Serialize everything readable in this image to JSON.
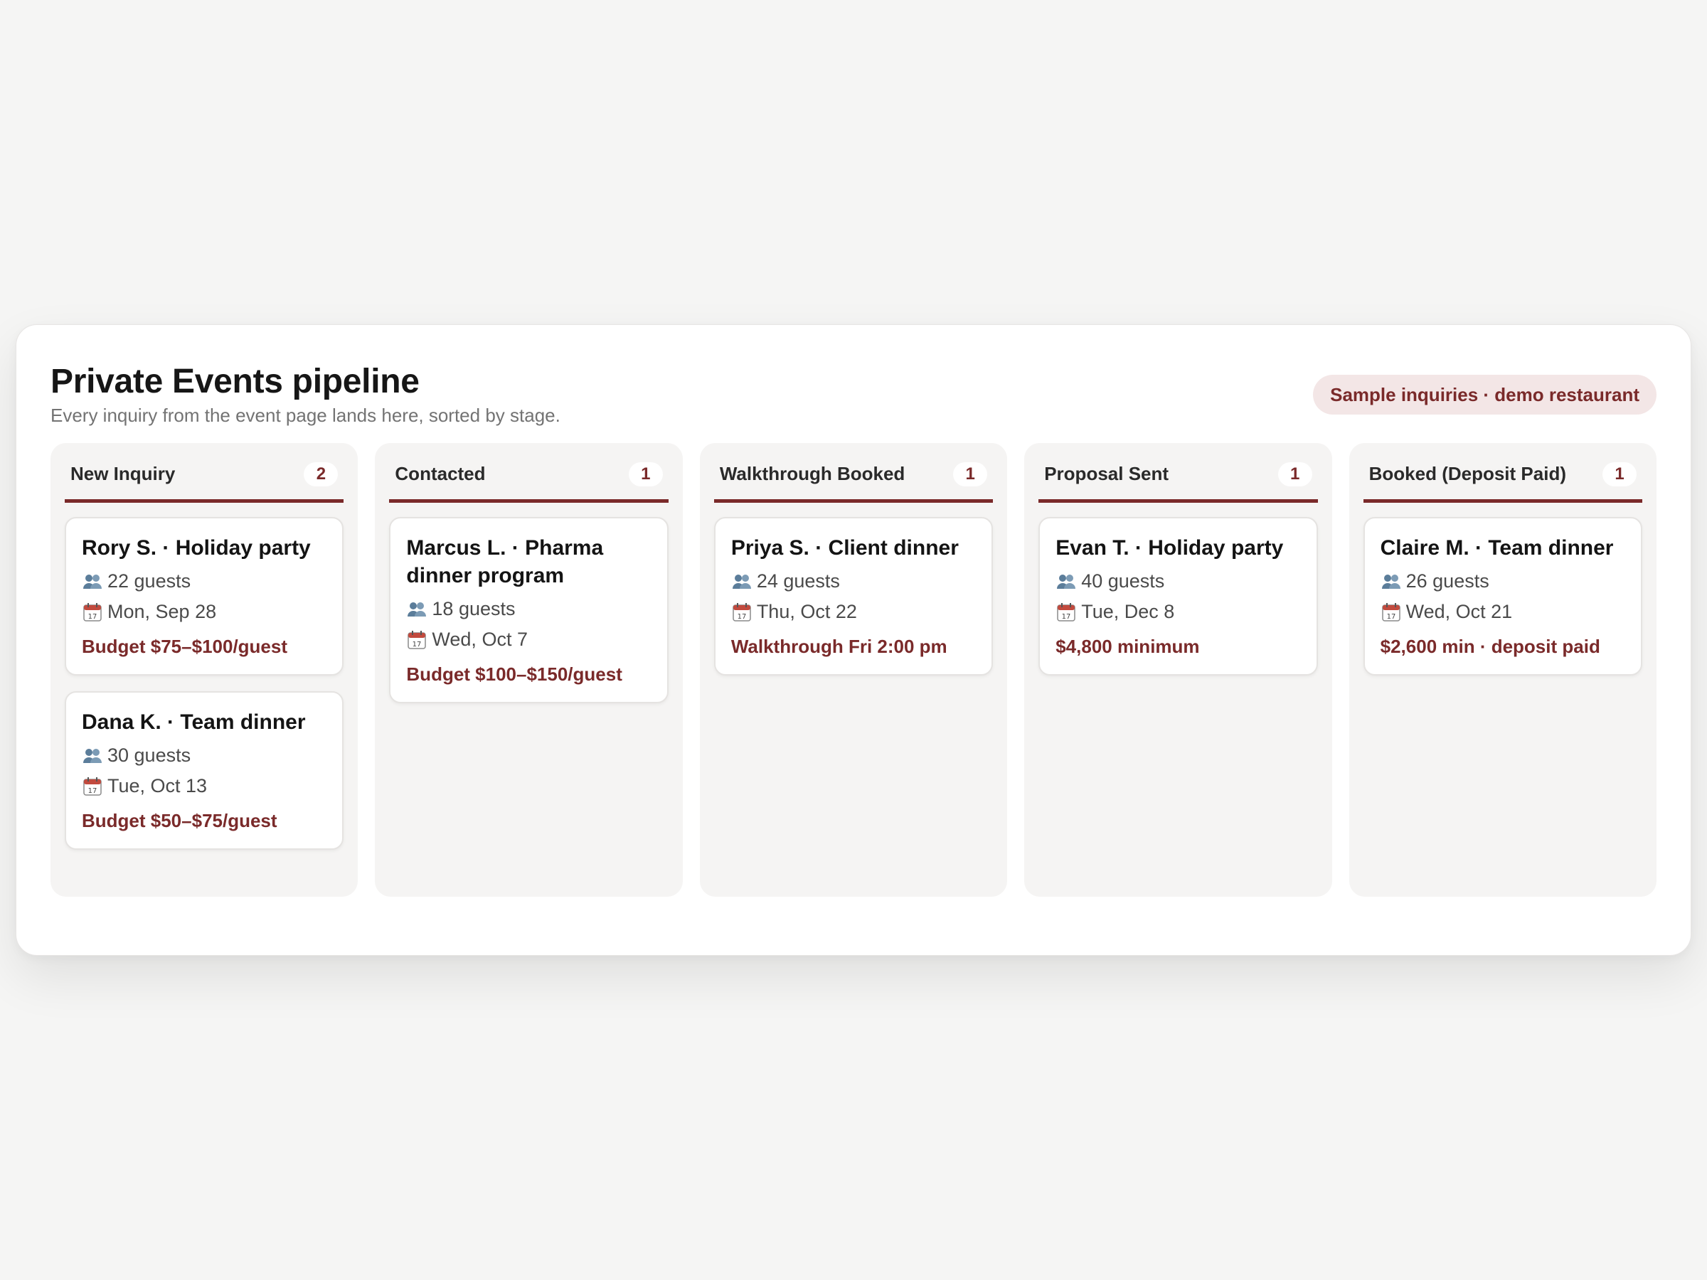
{
  "header": {
    "title": "Private Events pipeline",
    "subtitle": "Every inquiry from the event page lands here, sorted by stage.",
    "badge": "Sample inquiries · demo restaurant"
  },
  "colors": {
    "accent": "#7a2a2a",
    "badge_bg": "#f3e6e6"
  },
  "icons": {
    "guests": "people-icon",
    "date": "calendar-icon"
  },
  "columns": [
    {
      "name": "New Inquiry",
      "count": "2",
      "cards": [
        {
          "title": "Rory S. · Holiday party",
          "guests": "22 guests",
          "date": "Mon, Sep 28",
          "note": "Budget $75–$100/guest"
        },
        {
          "title": "Dana K. · Team dinner",
          "guests": "30 guests",
          "date": "Tue, Oct 13",
          "note": "Budget $50–$75/guest"
        }
      ]
    },
    {
      "name": "Contacted",
      "count": "1",
      "cards": [
        {
          "title": "Marcus L. · Pharma dinner program",
          "guests": "18 guests",
          "date": "Wed, Oct 7",
          "note": "Budget $100–$150/guest"
        }
      ]
    },
    {
      "name": "Walkthrough Booked",
      "count": "1",
      "cards": [
        {
          "title": "Priya S. · Client dinner",
          "guests": "24 guests",
          "date": "Thu, Oct 22",
          "note": "Walkthrough Fri 2:00 pm"
        }
      ]
    },
    {
      "name": "Proposal Sent",
      "count": "1",
      "cards": [
        {
          "title": "Evan T. · Holiday party",
          "guests": "40 guests",
          "date": "Tue, Dec 8",
          "note": "$4,800 minimum"
        }
      ]
    },
    {
      "name": "Booked (Deposit Paid)",
      "count": "1",
      "cards": [
        {
          "title": "Claire M. · Team dinner",
          "guests": "26 guests",
          "date": "Wed, Oct 21",
          "note": "$2,600 min · deposit paid"
        }
      ]
    }
  ]
}
